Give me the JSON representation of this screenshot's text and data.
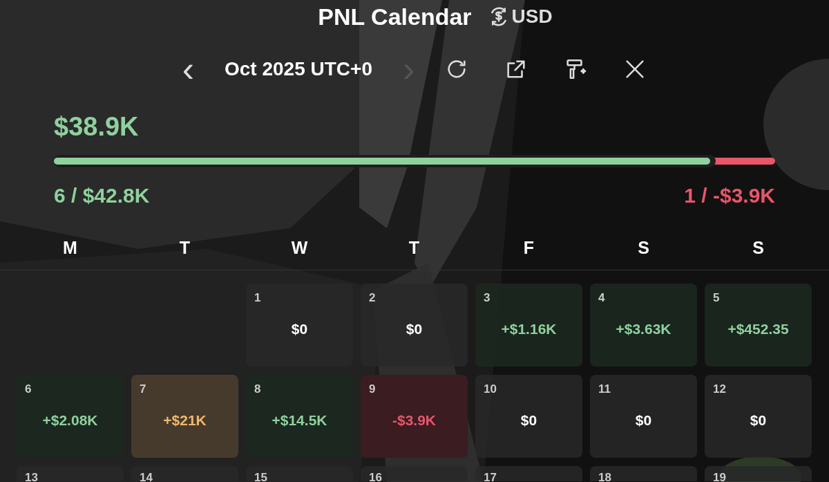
{
  "header": {
    "title": "PNL Calendar",
    "currency": "USD"
  },
  "nav": {
    "prev": {
      "label": "‹",
      "disabled": false
    },
    "month": "Oct 2025 UTC+0",
    "next": {
      "label": "›",
      "disabled": true
    }
  },
  "summary": {
    "total": "$38.9K",
    "level": 0.91,
    "wins": {
      "count": "6",
      "amount": "$42.8K"
    },
    "losses": {
      "count": "1",
      "amount": "-$3.9K"
    },
    "separator": "/"
  },
  "weekdays": [
    "M",
    "T",
    "W",
    "T",
    "F",
    "S",
    "S"
  ],
  "weeks": [
    [
      {
        "day": "1",
        "pnl": "$0",
        "kind": "zero"
      },
      {
        "day": "2",
        "pnl": "$0",
        "kind": "zero"
      },
      {
        "day": "3",
        "pnl": "+$1.16K",
        "kind": "gain"
      },
      {
        "day": "4",
        "pnl": "+$3.63K",
        "kind": "gain"
      },
      {
        "day": "5",
        "pnl": "+$452.35",
        "kind": "gain"
      }
    ],
    [
      {
        "day": "6",
        "pnl": "+$2.08K",
        "kind": "gain"
      },
      {
        "day": "7",
        "pnl": "+$21K",
        "kind": "top"
      },
      {
        "day": "8",
        "pnl": "+$14.5K",
        "kind": "gain"
      },
      {
        "day": "9",
        "pnl": "-$3.9K",
        "kind": "loss"
      },
      {
        "day": "10",
        "pnl": "$0",
        "kind": "zero"
      },
      {
        "day": "11",
        "pnl": "$0",
        "kind": "zero"
      },
      {
        "day": "12",
        "pnl": "$0",
        "kind": "zero"
      }
    ],
    [
      {
        "day": "13",
        "kind": "zero"
      },
      {
        "day": "14",
        "kind": "zero"
      },
      {
        "day": "15",
        "kind": "zero"
      },
      {
        "day": "16",
        "kind": "zero"
      },
      {
        "day": "17",
        "kind": "zero"
      },
      {
        "day": "18",
        "kind": "zero"
      },
      {
        "day": "19",
        "kind": "zero"
      }
    ]
  ]
}
